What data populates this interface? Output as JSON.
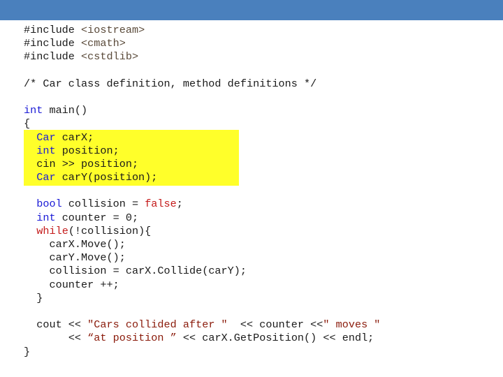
{
  "slide": {
    "accent_color": "#4a80bd",
    "highlight_color": "#ffff2a"
  },
  "code": {
    "includes": [
      {
        "directive": "#include",
        "header": "<iostream>"
      },
      {
        "directive": "#include",
        "header": "<cmath>"
      },
      {
        "directive": "#include",
        "header": "<cstdlib>"
      }
    ],
    "comment": "/* Car class definition, method definitions */",
    "main_sig": {
      "type": "int",
      "rest": " main()"
    },
    "open_brace": "{",
    "decl1": {
      "type": "Car",
      "rest": " carX;"
    },
    "decl2": {
      "type": "int",
      "rest": " position;"
    },
    "decl3": "cin >> position;",
    "decl4": {
      "type": "Car",
      "rest": " carY(position);"
    },
    "bool_line": {
      "type": "bool",
      "mid": " collision = ",
      "value": "false",
      "end": ";"
    },
    "counter_line": {
      "type": "int",
      "rest": " counter = 0;"
    },
    "while_line": {
      "kw": "while",
      "rest": "(!collision){"
    },
    "loop_body": [
      "carX.Move();",
      "carY.Move();",
      "collision = carX.Collide(carY);",
      "counter ++;"
    ],
    "loop_close": "}",
    "cout1": {
      "a": "cout << ",
      "s1": "\"Cars collided after \"",
      "b": "  << counter <<",
      "s2": "\" moves \""
    },
    "cout2": {
      "a": "<< ",
      "s1": "“at position ”",
      "b": " << carX.GetPosition() << endl;"
    },
    "close_brace": "}"
  }
}
